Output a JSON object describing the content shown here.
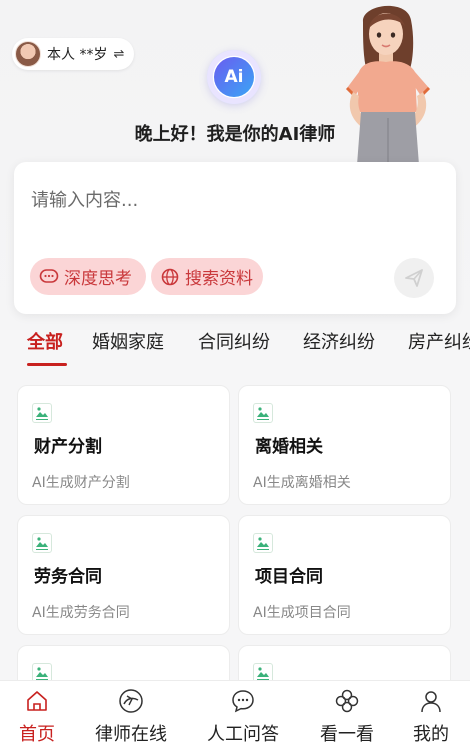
{
  "profile": {
    "label": "本人 **岁",
    "swap_icon": "swap-icon"
  },
  "greeting": "晚上好！我是你的AI律师",
  "logo_text": "Ai",
  "input": {
    "placeholder": "请输入内容..."
  },
  "actions": {
    "deep_think": "深度思考",
    "search_info": "搜索资料"
  },
  "tabs": [
    "全部",
    "婚姻家庭",
    "合同纠纷",
    "经济纠纷",
    "房产纠纷"
  ],
  "cards": [
    {
      "title": "财产分割",
      "subtitle": "AI生成财产分割"
    },
    {
      "title": "离婚相关",
      "subtitle": "AI生成离婚相关"
    },
    {
      "title": "劳务合同",
      "subtitle": "AI生成劳务合同"
    },
    {
      "title": "项目合同",
      "subtitle": "AI生成项目合同"
    }
  ],
  "nav": [
    {
      "label": "首页",
      "icon": "home-icon"
    },
    {
      "label": "律师在线",
      "icon": "lawyer-online-icon"
    },
    {
      "label": "人工问答",
      "icon": "chat-icon"
    },
    {
      "label": "看一看",
      "icon": "clover-icon"
    },
    {
      "label": "我的",
      "icon": "user-icon"
    }
  ],
  "colors": {
    "accent": "#c8211f",
    "pill_bg": "#fbd5d6",
    "pill_text": "#c9383b"
  }
}
